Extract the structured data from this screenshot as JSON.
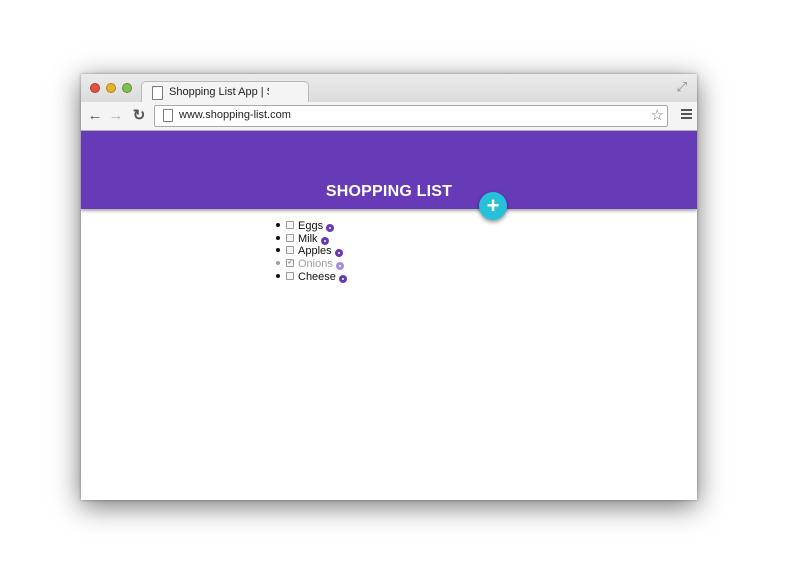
{
  "browser": {
    "tab_title": "Shopping List App | Shop",
    "url": "www.shopping-list.com"
  },
  "app": {
    "header_title": "SHOPPING LIST",
    "accent_color": "#673ab7",
    "add_button_color": "#26c1d9",
    "add_button_label": "+"
  },
  "items": [
    {
      "label": "Eggs",
      "checked": false
    },
    {
      "label": "Milk",
      "checked": false
    },
    {
      "label": "Apples",
      "checked": false
    },
    {
      "label": "Onions",
      "checked": true
    },
    {
      "label": "Cheese",
      "checked": false
    }
  ],
  "icons": {
    "back": "back-arrow-icon",
    "forward": "forward-arrow-icon",
    "reload": "reload-icon",
    "star": "star-icon",
    "menu": "hamburger-menu-icon",
    "page": "page-icon",
    "fullscreen": "fullscreen-icon"
  }
}
